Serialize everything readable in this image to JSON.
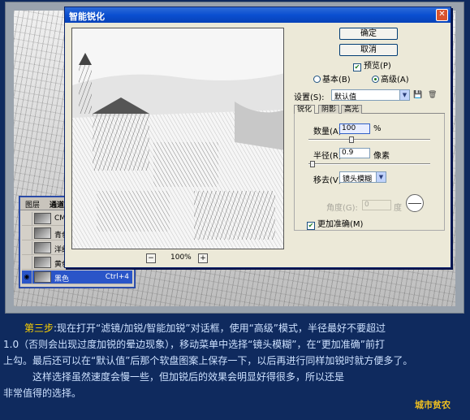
{
  "dialog": {
    "title": "智能锐化",
    "ok_label": "确定",
    "cancel_label": "取消",
    "preview_label": "预览(P)",
    "mode_basic": "基本(B)",
    "mode_advanced": "高级(A)",
    "settings_label": "设置(S):",
    "settings_value": "默认值",
    "tabs": [
      "锐化",
      "阴影",
      "高光"
    ],
    "amount_label": "数量(A):",
    "amount_value": "100",
    "amount_unit": "%",
    "radius_label": "半径(R):",
    "radius_value": "0.9",
    "radius_unit": "像素",
    "remove_label": "移去(V):",
    "remove_value": "镜头模糊",
    "angle_label": "角度(G):",
    "angle_value": "0",
    "angle_unit": "度",
    "more_accurate_label": "更加准确(M)",
    "zoom_value": "100%"
  },
  "channels": {
    "tabs": [
      "图层",
      "通道"
    ],
    "rows": [
      {
        "label": "CMY",
        "shortcut": ""
      },
      {
        "label": "青色",
        "shortcut": ""
      },
      {
        "label": "洋红",
        "shortcut": ""
      },
      {
        "label": "黄色",
        "shortcut": ""
      },
      {
        "label": "黑色",
        "shortcut": "Ctrl+4"
      }
    ]
  },
  "caption": {
    "step": "第三步",
    "line1": ":现在打开“滤镜/加锐/智能加锐”对话框，使用“高级”模式，半径最好不要超过",
    "line2": "1.0（否则会出现过度加锐的晕边现象），移动菜单中选择“镜头模糊”，在“更加准确”前打",
    "line3": "上勾。最后还可以在“默认值”后那个软盘图案上保存一下，以后再进行同样加锐时就方便多了。",
    "line4": "这样选择虽然速度会慢一些，但加锐后的效果会明显好得很多，所以还是",
    "line5": "非常值得的选择。"
  },
  "brand": "城市贫农",
  "colors": {
    "title_bar": "#0a4fd1",
    "caption_text": "#cde1ff",
    "step_text": "#ffd200",
    "brand_text": "#f0c020"
  }
}
